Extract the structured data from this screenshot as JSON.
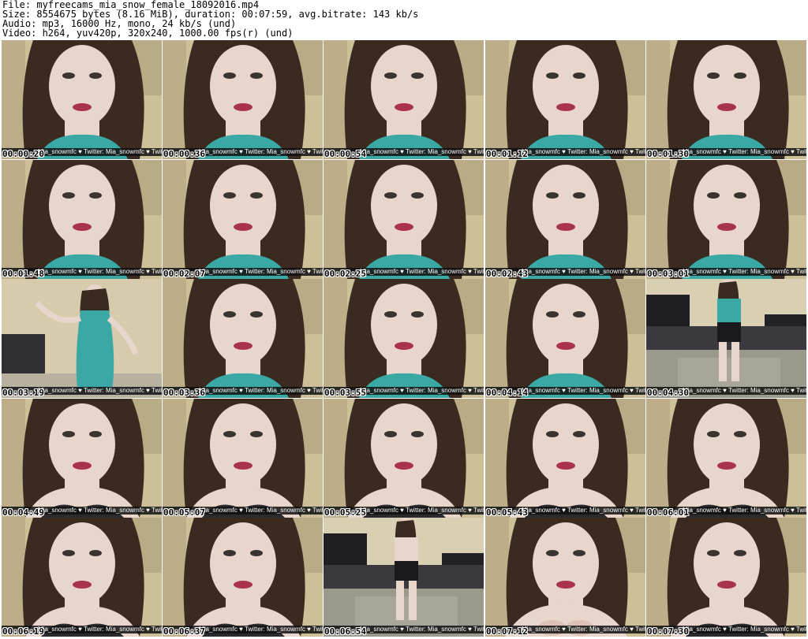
{
  "header": {
    "file_line": "File: myfreecams_mia_snow_female_18092016.mp4",
    "size_line": "Size: 8554675 bytes (8.16 MiB), duration: 00:07:59, avg.bitrate: 143 kb/s",
    "audio_line": "Audio: mp3, 16000 Hz, mono, 24 kb/s (und)",
    "video_line": "Video: h264, yuv420p, 320x240, 1000.00 fps(r) (und)"
  },
  "caption_text": "Mia_snowmfc ♥ Twitter: Mia_snowmfc ♥ Twitter: Mia_snowmfc",
  "colors": {
    "wall": "#cdbf98",
    "hair": "#3b2a1f",
    "skin": "#e8d5cc",
    "top_teal": "#3aa9a6",
    "bra_dark": "#2b2b2f",
    "floor": "#9c9a8a"
  },
  "thumbnails": [
    {
      "time": "00:00:20",
      "scene": "closeup-teal"
    },
    {
      "time": "00:00:36",
      "scene": "closeup-teal"
    },
    {
      "time": "00:00:54",
      "scene": "closeup-teal"
    },
    {
      "time": "00:01:12",
      "scene": "closeup-teal"
    },
    {
      "time": "00:01:30",
      "scene": "closeup-teal"
    },
    {
      "time": "00:01:48",
      "scene": "closeup-teal"
    },
    {
      "time": "00:02:07",
      "scene": "closeup-teal"
    },
    {
      "time": "00:02:25",
      "scene": "closeup-teal"
    },
    {
      "time": "00:02:43",
      "scene": "closeup-teal"
    },
    {
      "time": "00:03:01",
      "scene": "closeup-teal"
    },
    {
      "time": "00:03:19",
      "scene": "standing-teal"
    },
    {
      "time": "00:03:36",
      "scene": "closeup-teal"
    },
    {
      "time": "00:03:55",
      "scene": "closeup-teal"
    },
    {
      "time": "00:04:14",
      "scene": "closeup-teal"
    },
    {
      "time": "00:04:30",
      "scene": "room-standing"
    },
    {
      "time": "00:04:49",
      "scene": "closeup-bra"
    },
    {
      "time": "00:05:07",
      "scene": "closeup-bra"
    },
    {
      "time": "00:05:25",
      "scene": "closeup-bra"
    },
    {
      "time": "00:05:43",
      "scene": "closeup-bra"
    },
    {
      "time": "00:06:01",
      "scene": "closeup-bra"
    },
    {
      "time": "00:06:19",
      "scene": "closeup-bra"
    },
    {
      "time": "00:06:37",
      "scene": "closeup-bra"
    },
    {
      "time": "00:06:54",
      "scene": "room-back"
    },
    {
      "time": "00:07:12",
      "scene": "closeup-skin"
    },
    {
      "time": "00:07:30",
      "scene": "closeup-bra"
    }
  ]
}
